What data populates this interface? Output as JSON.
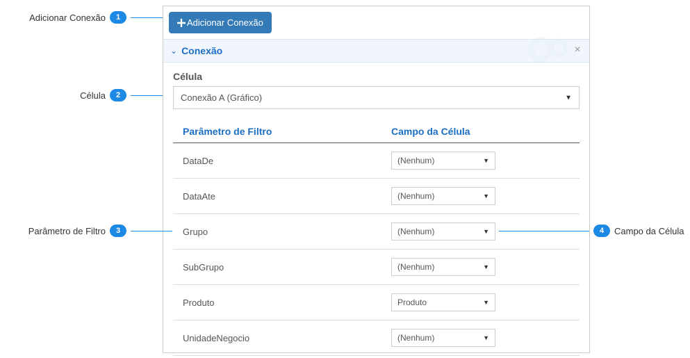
{
  "annotations": {
    "a1": "Adicionar Conexão",
    "a2": "Célula",
    "a3": "Parâmetro de Filtro",
    "a4": "Campo da Célula"
  },
  "button": {
    "add_label": "Adicionar Conexão"
  },
  "section": {
    "title": "Conexão"
  },
  "celula": {
    "label": "Célula",
    "value": "Conexão A (Gráfico)"
  },
  "table": {
    "header_param": "Parâmetro de Filtro",
    "header_campo": "Campo da Célula",
    "rows": [
      {
        "param": "DataDe",
        "campo": "(Nenhum)"
      },
      {
        "param": "DataAte",
        "campo": "(Nenhum)"
      },
      {
        "param": "Grupo",
        "campo": "(Nenhum)"
      },
      {
        "param": "SubGrupo",
        "campo": "(Nenhum)"
      },
      {
        "param": "Produto",
        "campo": "Produto"
      },
      {
        "param": "UnidadeNegocio",
        "campo": "(Nenhum)"
      }
    ]
  }
}
